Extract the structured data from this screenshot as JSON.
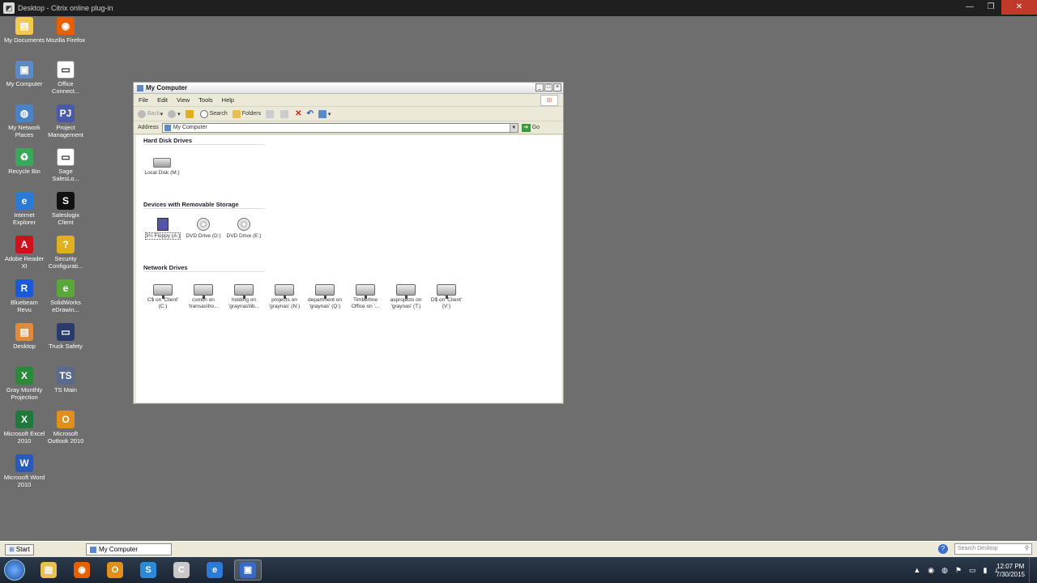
{
  "titlebar": {
    "title": "Desktop - Citrix online plug-in"
  },
  "desktop_icons": [
    {
      "label": "My Documents",
      "icon": "folder-icon",
      "color": "#f2c94c",
      "glyph": "▤"
    },
    {
      "label": "Mozilla Firefox",
      "icon": "firefox-icon",
      "color": "#e66000",
      "glyph": "◉"
    },
    {
      "label": "My Computer",
      "icon": "computer-icon",
      "color": "#5c8ac6",
      "glyph": "▣"
    },
    {
      "label": "Office Connect...",
      "icon": "shortcut-icon",
      "color": "#ffffff",
      "glyph": "▭"
    },
    {
      "label": "My Network Places",
      "icon": "network-icon",
      "color": "#4a82c8",
      "glyph": "◍"
    },
    {
      "label": "Project Management",
      "icon": "project-icon",
      "color": "#4a5aa8",
      "glyph": "PJ"
    },
    {
      "label": "Recycle Bin",
      "icon": "recycle-bin-icon",
      "color": "#3aa85a",
      "glyph": "♻"
    },
    {
      "label": "Sage SalesLo...",
      "icon": "shortcut-icon",
      "color": "#ffffff",
      "glyph": "▭"
    },
    {
      "label": "Internet Explorer",
      "icon": "ie-icon",
      "color": "#2a7ad8",
      "glyph": "e"
    },
    {
      "label": "Saleslogix Client",
      "icon": "saleslogix-icon",
      "color": "#111111",
      "glyph": "S"
    },
    {
      "label": "Adobe Reader XI",
      "icon": "adobe-reader-icon",
      "color": "#d0101a",
      "glyph": "A"
    },
    {
      "label": "Security Configurati...",
      "icon": "security-icon",
      "color": "#e0b020",
      "glyph": "?"
    },
    {
      "label": "Bluebeam Revu",
      "icon": "bluebeam-icon",
      "color": "#1a5ad8",
      "glyph": "R"
    },
    {
      "label": "SolidWorks eDrawin...",
      "icon": "solidworks-icon",
      "color": "#5aa83a",
      "glyph": "e"
    },
    {
      "label": "Desktop",
      "icon": "desktop-icon",
      "color": "#e08a3a",
      "glyph": "▤"
    },
    {
      "label": "Truck Safety",
      "icon": "truck-safety-icon",
      "color": "#2a3a6a",
      "glyph": "▭"
    },
    {
      "label": "Gray Monthly Projection",
      "icon": "excel-file-icon",
      "color": "#2a8a3a",
      "glyph": "X"
    },
    {
      "label": "TS Main",
      "icon": "ts-main-icon",
      "color": "#5a6a8a",
      "glyph": "TS"
    },
    {
      "label": "Microsoft Excel 2010",
      "icon": "excel-icon",
      "color": "#1e7a3a",
      "glyph": "X"
    },
    {
      "label": "Microsoft Outlook 2010",
      "icon": "outlook-icon",
      "color": "#e0901a",
      "glyph": "O"
    },
    {
      "label": "Microsoft Word 2010",
      "icon": "word-icon",
      "color": "#2a5ab8",
      "glyph": "W"
    }
  ],
  "window": {
    "title": "My Computer",
    "menu": [
      "File",
      "Edit",
      "View",
      "Tools",
      "Help"
    ],
    "toolbar": {
      "back": "Back",
      "search": "Search",
      "folders": "Folders"
    },
    "address": {
      "label": "Address",
      "value": "My Computer",
      "go": "Go"
    },
    "sections": {
      "hard_disk": "Hard Disk Drives",
      "removable": "Devices with Removable Storage",
      "network": "Network Drives"
    },
    "hard_disks": [
      {
        "label": "Local Disk (M:)"
      }
    ],
    "removable": [
      {
        "label": "3½ Floppy (A:)",
        "icon": "floppy-drive-icon"
      },
      {
        "label": "DVD Drive (D:)",
        "icon": "dvd-drive-icon"
      },
      {
        "label": "DVD Drive (E:)",
        "icon": "dvd-drive-icon"
      }
    ],
    "network_drives": [
      {
        "label": "C$ on 'Client' (C:)"
      },
      {
        "label": "csmith on 'transas\\ho..."
      },
      {
        "label": "holding on 'graynas\\lib..."
      },
      {
        "label": "projects on 'graynas' (N:)"
      },
      {
        "label": "department on 'graynas' (Q:)"
      },
      {
        "label": "Timberline Office on '..."
      },
      {
        "label": "asprojects on 'graynas' (T:)"
      },
      {
        "label": "D$ on 'Client' (V:)"
      }
    ]
  },
  "citrix_taskbar": {
    "start": "Start",
    "task": "My Computer",
    "search_placeholder": "Search Desktop"
  },
  "win7_taskbar": {
    "apps": [
      {
        "name": "windows-explorer",
        "color": "#e8c050",
        "glyph": "▤"
      },
      {
        "name": "firefox",
        "color": "#e66000",
        "glyph": "◉"
      },
      {
        "name": "outlook",
        "color": "#e0901a",
        "glyph": "O"
      },
      {
        "name": "skype",
        "color": "#2a8ad8",
        "glyph": "S"
      },
      {
        "name": "citrix-receiver",
        "color": "#c8c8c8",
        "glyph": "C"
      },
      {
        "name": "internet-explorer",
        "color": "#2a7ad8",
        "glyph": "e"
      },
      {
        "name": "citrix-desktop",
        "color": "#3a6ac8",
        "glyph": "▣"
      }
    ],
    "time": "12:07 PM",
    "date": "7/30/2015"
  }
}
